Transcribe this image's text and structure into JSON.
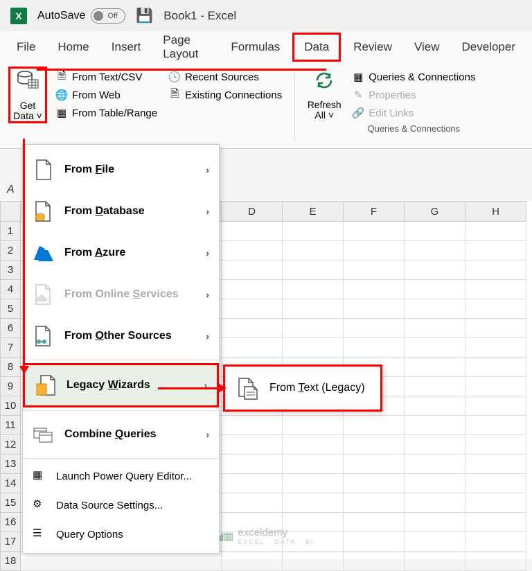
{
  "title": {
    "autosave_label": "AutoSave",
    "autosave_state": "Off",
    "doc": "Book1  -  Excel"
  },
  "tabs": [
    "File",
    "Home",
    "Insert",
    "Page Layout",
    "Formulas",
    "Data",
    "Review",
    "View",
    "Developer"
  ],
  "active_tab": "Data",
  "ribbon": {
    "get_data": {
      "label": "Get",
      "label2": "Data"
    },
    "col1": [
      "From Text/CSV",
      "From Web",
      "From Table/Range"
    ],
    "col2": [
      "Recent Sources",
      "Existing Connections"
    ],
    "refresh": {
      "label": "Refresh",
      "label2": "All"
    },
    "queries": {
      "items": [
        "Queries & Connections",
        "Properties",
        "Edit Links"
      ],
      "group_label": "Queries & Connections"
    }
  },
  "menu": {
    "items": [
      {
        "label": "From File",
        "key": "F"
      },
      {
        "label": "From Database",
        "key": "D"
      },
      {
        "label": "From Azure",
        "key": "A"
      },
      {
        "label": "From Online Services",
        "key": "S",
        "disabled": true
      },
      {
        "label": "From Other Sources",
        "key": "O"
      },
      {
        "label": "Legacy Wizards",
        "key": "W",
        "highlighted": true
      },
      {
        "label": "Combine Queries",
        "key": "Q"
      }
    ],
    "footer": [
      "Launch Power Query Editor...",
      "Data Source Settings...",
      "Query Options"
    ]
  },
  "submenu": {
    "label": "From Text (Legacy)",
    "key": "T"
  },
  "columns": [
    "D",
    "E",
    "F",
    "G",
    "H"
  ],
  "rows": [
    "1",
    "2",
    "3",
    "4",
    "5",
    "6",
    "7",
    "8",
    "9",
    "10",
    "11",
    "12",
    "13",
    "14",
    "15",
    "16",
    "17",
    "18"
  ],
  "watermark": {
    "name": "exceldemy",
    "tag": "EXCEL · DATA · BI"
  }
}
